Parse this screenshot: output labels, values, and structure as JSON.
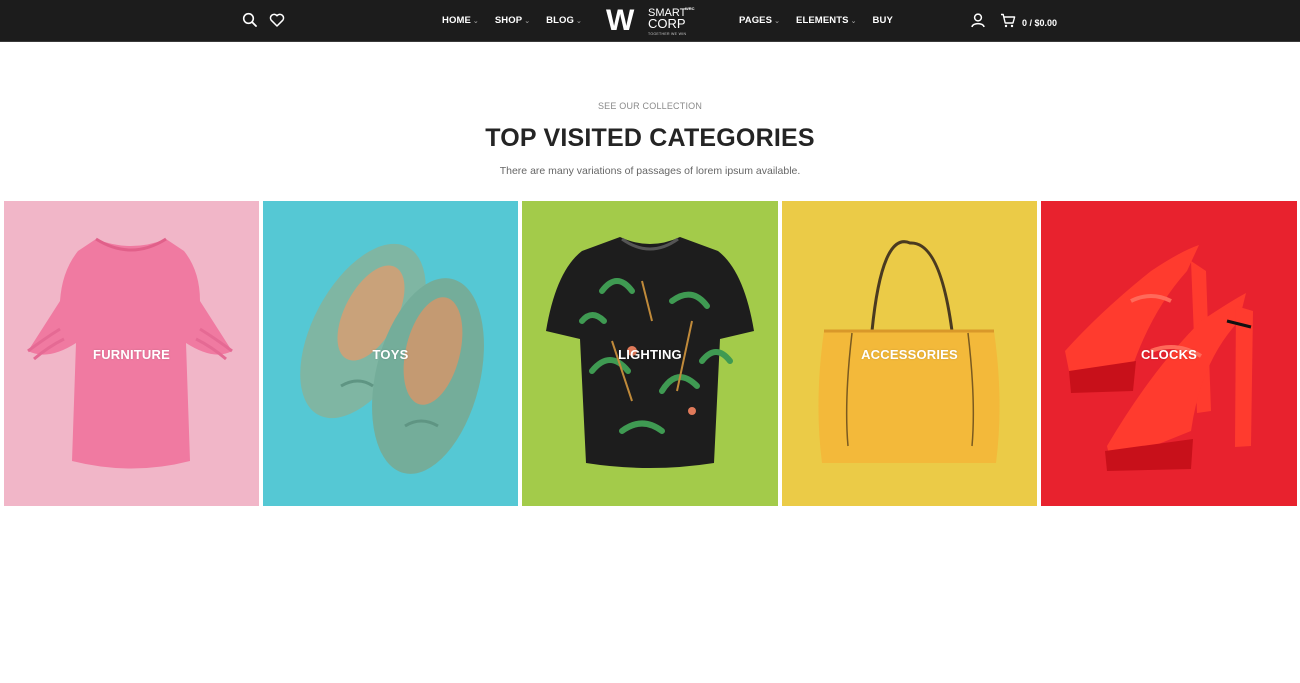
{
  "header": {
    "nav_left": [
      {
        "label": "HOME",
        "has_dropdown": true
      },
      {
        "label": "SHOP",
        "has_dropdown": true
      },
      {
        "label": "BLOG",
        "has_dropdown": true
      }
    ],
    "nav_right": [
      {
        "label": "PAGES",
        "has_dropdown": true
      },
      {
        "label": "ELEMENTS",
        "has_dropdown": true
      },
      {
        "label": "BUY",
        "has_dropdown": false
      }
    ],
    "logo": {
      "mark": "W",
      "line1": "SMART",
      "line2": "CORP",
      "sup": "WRC",
      "tagline": "TOGETHER WE WIN"
    },
    "cart_text": "0 / $0.00",
    "icons": [
      "search-icon",
      "heart-icon",
      "user-icon",
      "cart-icon"
    ]
  },
  "section": {
    "eyebrow": "SEE OUR COLLECTION",
    "heading": "TOP VISITED CATEGORIES",
    "subtitle": "There are many variations of passages of lorem ipsum available."
  },
  "categories": [
    {
      "label": "FURNITURE",
      "bg": "#f1b6c8",
      "product": "pink-ruffle-blouse"
    },
    {
      "label": "TOYS",
      "bg": "#55c8d4",
      "product": "teal-suede-loafers"
    },
    {
      "label": "LIGHTING",
      "bg": "#a3cb4a",
      "product": "tropical-print-tshirt"
    },
    {
      "label": "ACCESSORIES",
      "bg": "#ebcb47",
      "product": "yellow-tote-bag"
    },
    {
      "label": "CLOCKS",
      "bg": "#e8222e",
      "product": "red-strappy-heels"
    }
  ]
}
